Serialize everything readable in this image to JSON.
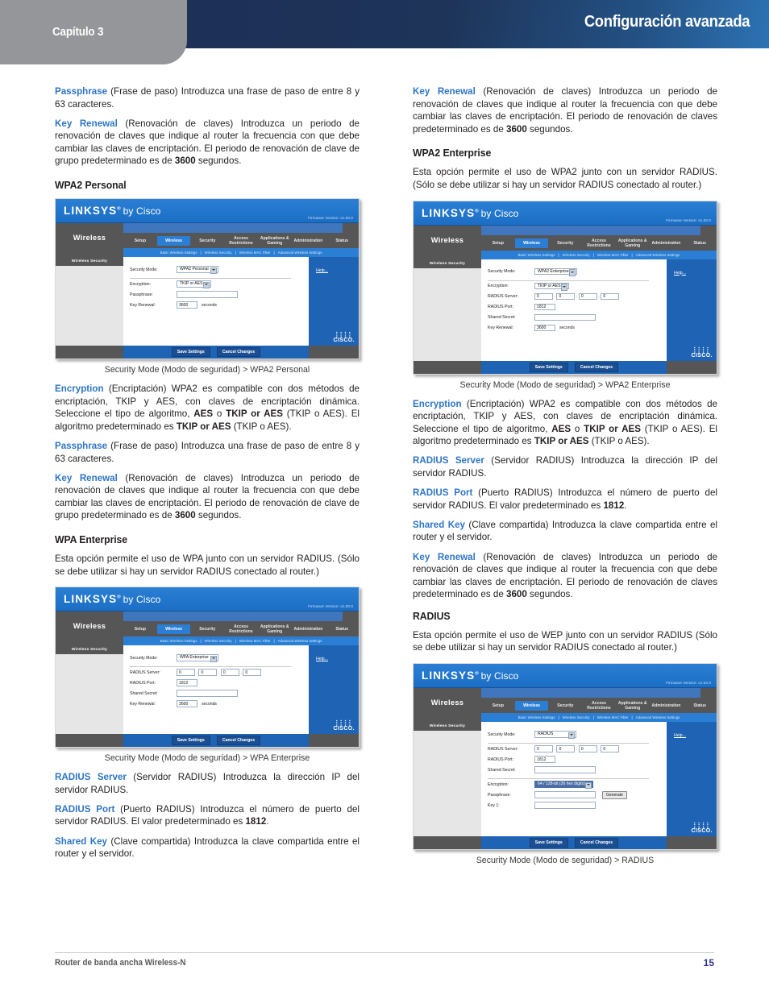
{
  "header": {
    "chapter": "Capítulo 3",
    "title": "Configuración avanzada"
  },
  "footer": {
    "left": "Router de banda ancha Wireless-N",
    "page": "15"
  },
  "left_column": {
    "p1": {
      "term": "Passphrase",
      "text": " (Frase de paso) Introduzca una frase de paso de entre 8 y 63 caracteres."
    },
    "p2": {
      "term": "Key Renewal",
      "t1": " (Renovación de claves) Introduzca un periodo de renovación de claves que indique al router la frecuencia con que debe cambiar las claves de encriptación. El periodo de renovación de clave de grupo predeterminado es de ",
      "b1": "3600",
      "t2": " segundos."
    },
    "h_wpa2_personal": "WPA2 Personal",
    "caption1": "Security Mode (Modo de seguridad) > WPA2 Personal",
    "p3": {
      "term": "Encryption",
      "t1": " (Encriptación) WPA2 es compatible con dos métodos de encriptación, TKIP y AES, con claves de encriptación dinámica. Seleccione el tipo de algoritmo, ",
      "b1": "AES",
      "t2": " o ",
      "b2": "TKIP or AES",
      "t3": " (TKIP o AES). El algoritmo predeterminado es ",
      "b3": "TKIP or AES",
      "t4": " (TKIP o AES)."
    },
    "p4": {
      "term": "Passphrase",
      "text": " (Frase de paso) Introduzca una frase de paso de entre 8 y 63 caracteres."
    },
    "p5": {
      "term": "Key Renewal",
      "t1": " (Renovación de claves) Introduzca un periodo de renovación de claves que indique al router la frecuencia con que debe cambiar las claves de encriptación. El periodo de renovación de clave de grupo predeterminado es de ",
      "b1": "3600",
      "t2": " segundos."
    },
    "h_wpa_enterprise": "WPA Enterprise",
    "p6": "Esta opción permite el uso de WPA junto con un servidor RADIUS. (Sólo se debe utilizar si hay un servidor RADIUS conectado al router.)",
    "caption2": "Security Mode (Modo de seguridad) > WPA Enterprise",
    "p7": {
      "term": "RADIUS Server",
      "text": " (Servidor RADIUS) Introduzca la dirección IP del servidor RADIUS."
    },
    "p8": {
      "term": "RADIUS Port",
      "t1": " (Puerto RADIUS) Introduzca el número de puerto del servidor RADIUS. El valor predeterminado es ",
      "b1": "1812",
      "t2": "."
    },
    "p9": {
      "term": "Shared Key",
      "text": "  (Clave compartida) Introduzca la clave compartida entre el router y el servidor."
    }
  },
  "right_column": {
    "p1": {
      "term": "Key Renewal",
      "t1": " (Renovación de claves) Introduzca un periodo de renovación de claves que indique al router la frecuencia con que debe cambiar las claves de encriptación. El periodo de renovación de claves predeterminado es de ",
      "b1": "3600",
      "t2": " segundos."
    },
    "h_wpa2_enterprise": "WPA2 Enterprise",
    "p2": "Esta opción permite el uso de WPA2 junto con un servidor RADIUS. (Sólo se debe utilizar si hay un servidor RADIUS conectado al router.)",
    "caption1": "Security Mode (Modo de seguridad) > WPA2 Enterprise",
    "p3": {
      "term": "Encryption",
      "t1": "  (Encriptación) WPA2 es compatible con dos métodos de encriptación, TKIP y AES, con claves de encriptación dinámica. Seleccione el tipo de algoritmo, ",
      "b1": "AES",
      "t2": " o ",
      "b2": "TKIP or AES",
      "t3": " (TKIP o AES). El algoritmo predeterminado es ",
      "b3": "TKIP or AES",
      "t4": " (TKIP o AES)."
    },
    "p4": {
      "term": "RADIUS Server",
      "text": " (Servidor RADIUS) Introduzca la dirección IP del servidor RADIUS."
    },
    "p5": {
      "term": "RADIUS Port",
      "t1": " (Puerto RADIUS) Introduzca el número de puerto del servidor RADIUS. El valor predeterminado es ",
      "b1": "1812",
      "t2": "."
    },
    "p6": {
      "term": "Shared Key",
      "text": " (Clave compartida) Introduzca la clave compartida entre el router y el servidor."
    },
    "p7": {
      "term": "Key Renewal",
      "t1": " (Renovación de claves) Introduzca un periodo de renovación de claves que indique al router la frecuencia con que debe cambiar las claves de encriptación. El periodo de renovación de claves predeterminado es de ",
      "b1": "3600",
      "t2": " segundos."
    },
    "h_radius": "RADIUS",
    "p8": "Esta opción permite el uso de WEP junto con un servidor RADIUS (Sólo se debe utilizar si hay un servidor RADIUS conectado al router.)",
    "caption2": "Security Mode (Modo de seguridad) > RADIUS"
  },
  "router_ui": {
    "brand": "LINKSYS",
    "brand_reg": "®",
    "brand_by": "by Cisco",
    "firmware": "Firmware Version: v1.00.0",
    "app_name": "Wireless",
    "tabs": [
      "Setup",
      "Wireless",
      "Security",
      "Access Restrictions",
      "Applications & Gaming",
      "Administration",
      "Status"
    ],
    "active_tab": "Wireless",
    "subnav": [
      "Basic Wireless Settings",
      "Wireless Security",
      "Wireless MAC Filter",
      "Advanced Wireless Settings"
    ],
    "sidebar_title": "Wireless Security",
    "help_link": "Help...",
    "cisco_word": "CISCO.",
    "save_button": "Save Settings",
    "cancel_button": "Cancel Changes",
    "labels": {
      "security_mode": "Security Mode:",
      "encryption": "Encryption:",
      "passphrase": "Passphrase:",
      "key_renewal": "Key Renewal:",
      "radius_server": "RADIUS Server:",
      "radius_port": "RADIUS Port:",
      "shared_secret": "Shared Secret:",
      "key1": "Key 1:",
      "seconds": "seconds",
      "generate": "Generate"
    },
    "shot1": {
      "security_mode": "WPA2 Personal",
      "encryption": "TKIP or AES",
      "passphrase": "",
      "key_renewal": "3600"
    },
    "shot2": {
      "security_mode": "WPA Enterprise",
      "radius_ip": [
        "0",
        "0",
        "0",
        "0"
      ],
      "radius_port": "1812",
      "shared_secret": "",
      "key_renewal": "3600"
    },
    "shot3": {
      "security_mode": "WPA2 Enterprise",
      "encryption": "TKIP or AES",
      "radius_ip": [
        "0",
        "0",
        "0",
        "0"
      ],
      "radius_port": "1812",
      "shared_secret": "",
      "key_renewal": "3600"
    },
    "shot4": {
      "security_mode": "RADIUS",
      "radius_ip": [
        "0",
        "0",
        "0",
        "0"
      ],
      "radius_port": "1812",
      "shared_secret": "",
      "encryption": "64 / 128-bit (26 hex digits)",
      "passphrase": "",
      "key1": ""
    }
  }
}
